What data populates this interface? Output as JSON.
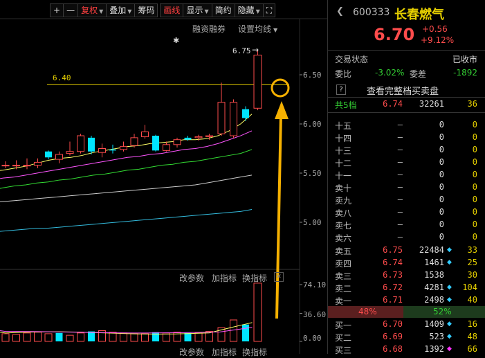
{
  "toolbar": {
    "plus": "+",
    "minus": "—",
    "fuquan": "复权",
    "diejia": "叠加",
    "chouma": "筹码",
    "huaxian": "画线",
    "xianshi": "显示",
    "jianyue": "简约",
    "yincang": "隐藏",
    "fullscreen_icon": "⛶"
  },
  "chart_top": {
    "rongzi": "融资融券",
    "settings": "设置均线"
  },
  "price_axis": [
    "6.50",
    "6.00",
    "5.50",
    "5.00"
  ],
  "annotations": {
    "high": "6.75",
    "line_value": "6.40",
    "star": "✱"
  },
  "indicator_toolbar": {
    "gai": "改参数",
    "jia": "加指标",
    "huan": "换指标",
    "close": "✕"
  },
  "volume_axis": [
    "74.10",
    "36.60",
    "0.00"
  ],
  "chart_data": [
    {
      "type": "candlestick",
      "title": "",
      "yticks": [
        5.0,
        5.5,
        6.0,
        6.5
      ],
      "ylim": [
        4.75,
        6.85
      ],
      "horizontal_line": 6.4,
      "high_marker": 6.75,
      "candles": [
        {
          "o": 5.58,
          "c": 5.58,
          "h": 5.62,
          "l": 5.55
        },
        {
          "o": 5.58,
          "c": 5.58,
          "h": 5.63,
          "l": 5.54
        },
        {
          "o": 5.58,
          "c": 5.58,
          "h": 5.65,
          "l": 5.54
        },
        {
          "o": 5.58,
          "c": 5.61,
          "h": 5.65,
          "l": 5.55
        },
        {
          "o": 5.72,
          "c": 5.66,
          "h": 5.73,
          "l": 5.64
        },
        {
          "o": 5.64,
          "c": 5.69,
          "h": 5.72,
          "l": 5.6
        },
        {
          "o": 5.7,
          "c": 5.72,
          "h": 5.82,
          "l": 5.68
        },
        {
          "o": 5.72,
          "c": 5.88,
          "h": 5.9,
          "l": 5.7
        },
        {
          "o": 5.86,
          "c": 5.72,
          "h": 5.88,
          "l": 5.69
        },
        {
          "o": 5.71,
          "c": 5.75,
          "h": 5.8,
          "l": 5.66
        },
        {
          "o": 5.74,
          "c": 5.73,
          "h": 5.79,
          "l": 5.7
        },
        {
          "o": 5.74,
          "c": 5.77,
          "h": 5.82,
          "l": 5.72
        },
        {
          "o": 5.78,
          "c": 5.86,
          "h": 5.9,
          "l": 5.76
        },
        {
          "o": 5.87,
          "c": 5.92,
          "h": 5.99,
          "l": 5.85
        },
        {
          "o": 5.88,
          "c": 5.73,
          "h": 5.89,
          "l": 5.72
        },
        {
          "o": 5.73,
          "c": 5.79,
          "h": 5.82,
          "l": 5.72
        },
        {
          "o": 5.79,
          "c": 5.84,
          "h": 5.86,
          "l": 5.76
        },
        {
          "o": 5.86,
          "c": 5.84,
          "h": 5.88,
          "l": 5.83
        },
        {
          "o": 5.86,
          "c": 5.87,
          "h": 5.89,
          "l": 5.83
        },
        {
          "o": 5.87,
          "c": 5.88,
          "h": 5.9,
          "l": 5.84
        },
        {
          "o": 5.9,
          "c": 6.22,
          "h": 6.42,
          "l": 5.88
        },
        {
          "o": 5.88,
          "c": 6.22,
          "h": 6.25,
          "l": 5.86
        },
        {
          "o": 6.15,
          "c": 6.06,
          "h": 6.18,
          "l": 6.03
        },
        {
          "o": 6.16,
          "c": 6.7,
          "h": 6.75,
          "l": 6.14
        }
      ],
      "ma_lines": [
        {
          "color": "#ffff66",
          "values": [
            5.52,
            5.53,
            5.55,
            5.57,
            5.6,
            5.63,
            5.65,
            5.66,
            5.68,
            5.71,
            5.73,
            5.75,
            5.77,
            5.78,
            5.8,
            5.81,
            5.82,
            5.84,
            5.84,
            5.85,
            5.88,
            5.93,
            6.0,
            6.1
          ]
        },
        {
          "color": "#ff55ff",
          "values": [
            5.43,
            5.45,
            5.46,
            5.48,
            5.5,
            5.52,
            5.54,
            5.56,
            5.58,
            5.6,
            5.62,
            5.64,
            5.66,
            5.67,
            5.69,
            5.7,
            5.72,
            5.74,
            5.75,
            5.77,
            5.8,
            5.84,
            5.88,
            5.93
          ]
        },
        {
          "color": "#33dd33",
          "values": [
            5.33,
            5.35,
            5.37,
            5.38,
            5.4,
            5.41,
            5.43,
            5.44,
            5.46,
            5.48,
            5.49,
            5.51,
            5.53,
            5.54,
            5.56,
            5.58,
            5.59,
            5.61,
            5.62,
            5.64,
            5.66,
            5.68,
            5.7,
            5.74
          ]
        },
        {
          "color": "#cccccc",
          "values": [
            5.2,
            5.21,
            5.22,
            5.23,
            5.24,
            5.25,
            5.26,
            5.27,
            5.28,
            5.29,
            5.3,
            5.31,
            5.32,
            5.33,
            5.34,
            5.35,
            5.36,
            5.37,
            5.38,
            5.4,
            5.42,
            5.44,
            5.46,
            5.48
          ]
        },
        {
          "color": "#33bbdd",
          "values": [
            4.9,
            4.91,
            4.92,
            4.93,
            4.94,
            4.94,
            4.95,
            4.96,
            4.97,
            4.98,
            4.99,
            5.0,
            5.01,
            5.02,
            5.03,
            5.04,
            5.05,
            5.06,
            5.07,
            5.08,
            5.09,
            5.1,
            5.11,
            5.13
          ]
        }
      ]
    },
    {
      "type": "bar",
      "title": "",
      "yticks": [
        0.0,
        36.6,
        74.1
      ],
      "ylim": [
        0,
        80
      ],
      "values": [
        10,
        9,
        11,
        12,
        10,
        11,
        8,
        11,
        13,
        14,
        12,
        11,
        10,
        10,
        12,
        11,
        12,
        11,
        11,
        13,
        18,
        28,
        22,
        76
      ],
      "colors": [
        "r",
        "r",
        "r",
        "r",
        "r",
        "c",
        "r",
        "r",
        "c",
        "r",
        "r",
        "r",
        "r",
        "r",
        "c",
        "r",
        "r",
        "c",
        "r",
        "r",
        "r",
        "r",
        "c",
        "r"
      ]
    }
  ],
  "stock": {
    "code": "600333",
    "name": "长春燃气",
    "price": "6.70",
    "change": "+0.56",
    "pct": "+9.12%"
  },
  "status": {
    "label": "交易状态",
    "value": "已收市"
  },
  "weibi": {
    "label": "委比",
    "value": "-3.02%",
    "diff_label": "委差",
    "diff": "-1892"
  },
  "full_book": {
    "q": "?",
    "text": "查看完整档买卖盘"
  },
  "gong5": {
    "label": "共5档",
    "price": "6.74",
    "vol": "32261",
    "cnt": "36"
  },
  "deep_asks": [
    {
      "label": "十五",
      "price": "—",
      "vol": "0",
      "cnt": "0"
    },
    {
      "label": "十四",
      "price": "—",
      "vol": "0",
      "cnt": "0"
    },
    {
      "label": "十三",
      "price": "—",
      "vol": "0",
      "cnt": "0"
    },
    {
      "label": "十二",
      "price": "—",
      "vol": "0",
      "cnt": "0"
    },
    {
      "label": "十一",
      "price": "—",
      "vol": "0",
      "cnt": "0"
    },
    {
      "label": "卖十",
      "price": "—",
      "vol": "0",
      "cnt": "0"
    },
    {
      "label": "卖九",
      "price": "—",
      "vol": "0",
      "cnt": "0"
    },
    {
      "label": "卖八",
      "price": "—",
      "vol": "0",
      "cnt": "0"
    },
    {
      "label": "卖七",
      "price": "—",
      "vol": "0",
      "cnt": "0"
    },
    {
      "label": "卖六",
      "price": "—",
      "vol": "0",
      "cnt": "0"
    }
  ],
  "asks": [
    {
      "label": "卖五",
      "price": "6.75",
      "vol": "22484",
      "mark": "◆",
      "markColor": "#33ccff",
      "cnt": "33"
    },
    {
      "label": "卖四",
      "price": "6.74",
      "vol": "1461",
      "mark": "◆",
      "markColor": "#33ccff",
      "cnt": "25"
    },
    {
      "label": "卖三",
      "price": "6.73",
      "vol": "1538",
      "mark": "",
      "markColor": "",
      "cnt": "30"
    },
    {
      "label": "卖二",
      "price": "6.72",
      "vol": "4281",
      "mark": "◆",
      "markColor": "#33ccff",
      "cnt": "104"
    },
    {
      "label": "卖一",
      "price": "6.71",
      "vol": "2498",
      "mark": "◆",
      "markColor": "#33ccff",
      "cnt": "40"
    }
  ],
  "ratio": {
    "sell": "48%",
    "buy": "52%",
    "sell_fraction": 0.48
  },
  "bids": [
    {
      "label": "买一",
      "price": "6.70",
      "vol": "1409",
      "mark": "◆",
      "markColor": "#33ccff",
      "cnt": "16"
    },
    {
      "label": "买二",
      "price": "6.69",
      "vol": "523",
      "mark": "◆",
      "markColor": "#33ccff",
      "cnt": "48"
    },
    {
      "label": "买三",
      "price": "6.68",
      "vol": "1392",
      "mark": "◆",
      "markColor": "#ff33ff",
      "cnt": "66"
    }
  ]
}
